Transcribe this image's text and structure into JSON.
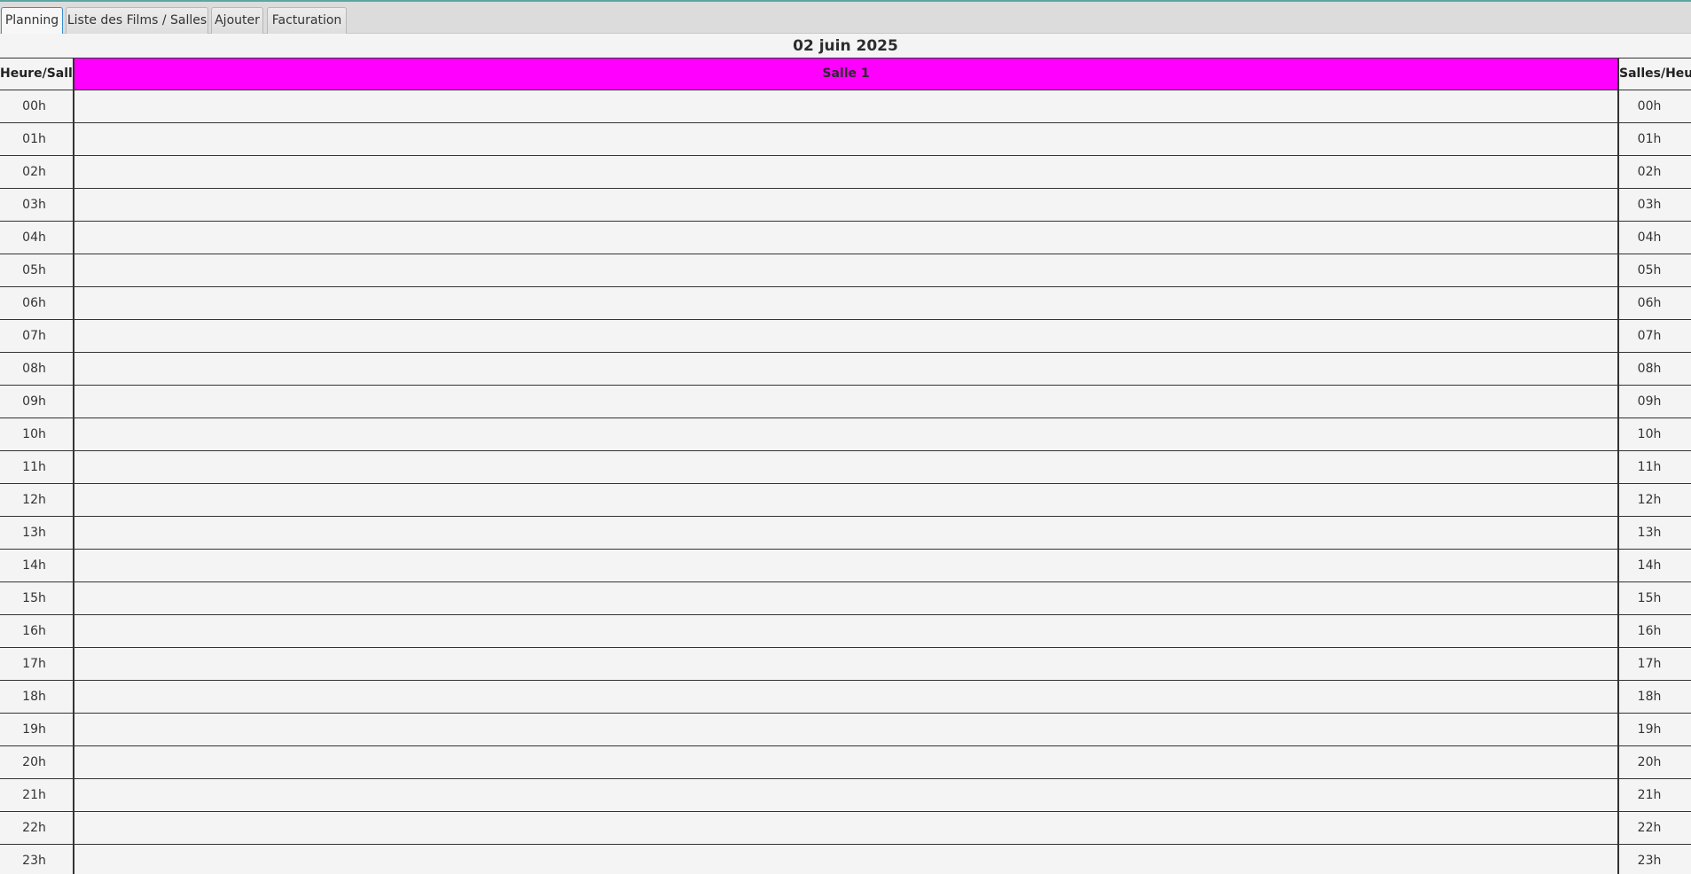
{
  "tabs": [
    {
      "label": "Planning",
      "active": true
    },
    {
      "label": "Liste des Films / Salles",
      "active": false
    },
    {
      "label": "Ajouter",
      "active": false
    },
    {
      "label": "Facturation",
      "active": false
    }
  ],
  "planning": {
    "date": "02 juin 2025",
    "left_header": "Heure/Salles",
    "right_header": "Salles/Heure",
    "salle": "Salle 1",
    "salle_color": "#ff00ff",
    "hours": [
      "00h",
      "01h",
      "02h",
      "03h",
      "04h",
      "05h",
      "06h",
      "07h",
      "08h",
      "09h",
      "10h",
      "11h",
      "12h",
      "13h",
      "14h",
      "15h",
      "16h",
      "17h",
      "18h",
      "19h",
      "20h",
      "21h",
      "22h",
      "23h"
    ]
  }
}
